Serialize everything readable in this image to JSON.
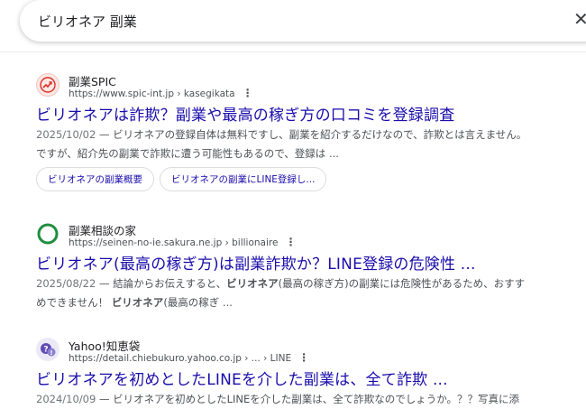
{
  "search": {
    "query": "ビリオネア 副業",
    "clear_icon": "close-icon"
  },
  "results": [
    {
      "site_name": "副業SPIC",
      "url": "https://www.spic-int.jp › kasegikata",
      "title": "ビリオネアは詐欺？副業や最高の稼ぎ方の口コミを登録調査",
      "date": "2025/10/02",
      "snippet_line1": " — ビリオネアの登録自体は無料ですし、副業を紹介するだけなので、詐欺とは言えません。",
      "snippet_line2": "ですが、紹介先の副業で詐欺に遭う可能性もあるので、登録は ...",
      "chips": [
        "ビリオネアの副業概要",
        "ビリオネアの副業にLINE登録し..."
      ],
      "favicon": "trend-up-icon",
      "favicon_color": "#d93025"
    },
    {
      "site_name": "副業相談の家",
      "url": "https://seinen-no-ie.sakura.ne.jp › billionaire",
      "title": "ビリオネア(最高の稼ぎ方)は副業詐欺か？LINE登録の危険性 ...",
      "date": "2025/08/22",
      "snippet_line1_pre": " — 結論からお伝えすると、",
      "snippet_line1_bold": "ビリオネア",
      "snippet_line1_post": "(最高の稼ぎ方)の副業には危険性があるため、おすす",
      "snippet_line2_pre": "めできません！ ",
      "snippet_line2_bold": "ビリオネア",
      "snippet_line2_post": "(最高の稼ぎ ...",
      "favicon": "ring-icon",
      "favicon_color": "#1e8e3e"
    },
    {
      "site_name": "Yahoo!知恵袋",
      "url": "https://detail.chiebukuro.yahoo.co.jp › ... › LINE",
      "title": "ビリオネアを初めとしたLINEを介した副業は、全て詐欺 ...",
      "date": "2024/10/09",
      "snippet_line1": " — ビリオネアを初めとしたLINEを介した副業は、全て詐欺なのでしょうか。？？写真に添",
      "favicon": "question-bubble-icon",
      "favicon_color": "#5f4bb6"
    }
  ]
}
